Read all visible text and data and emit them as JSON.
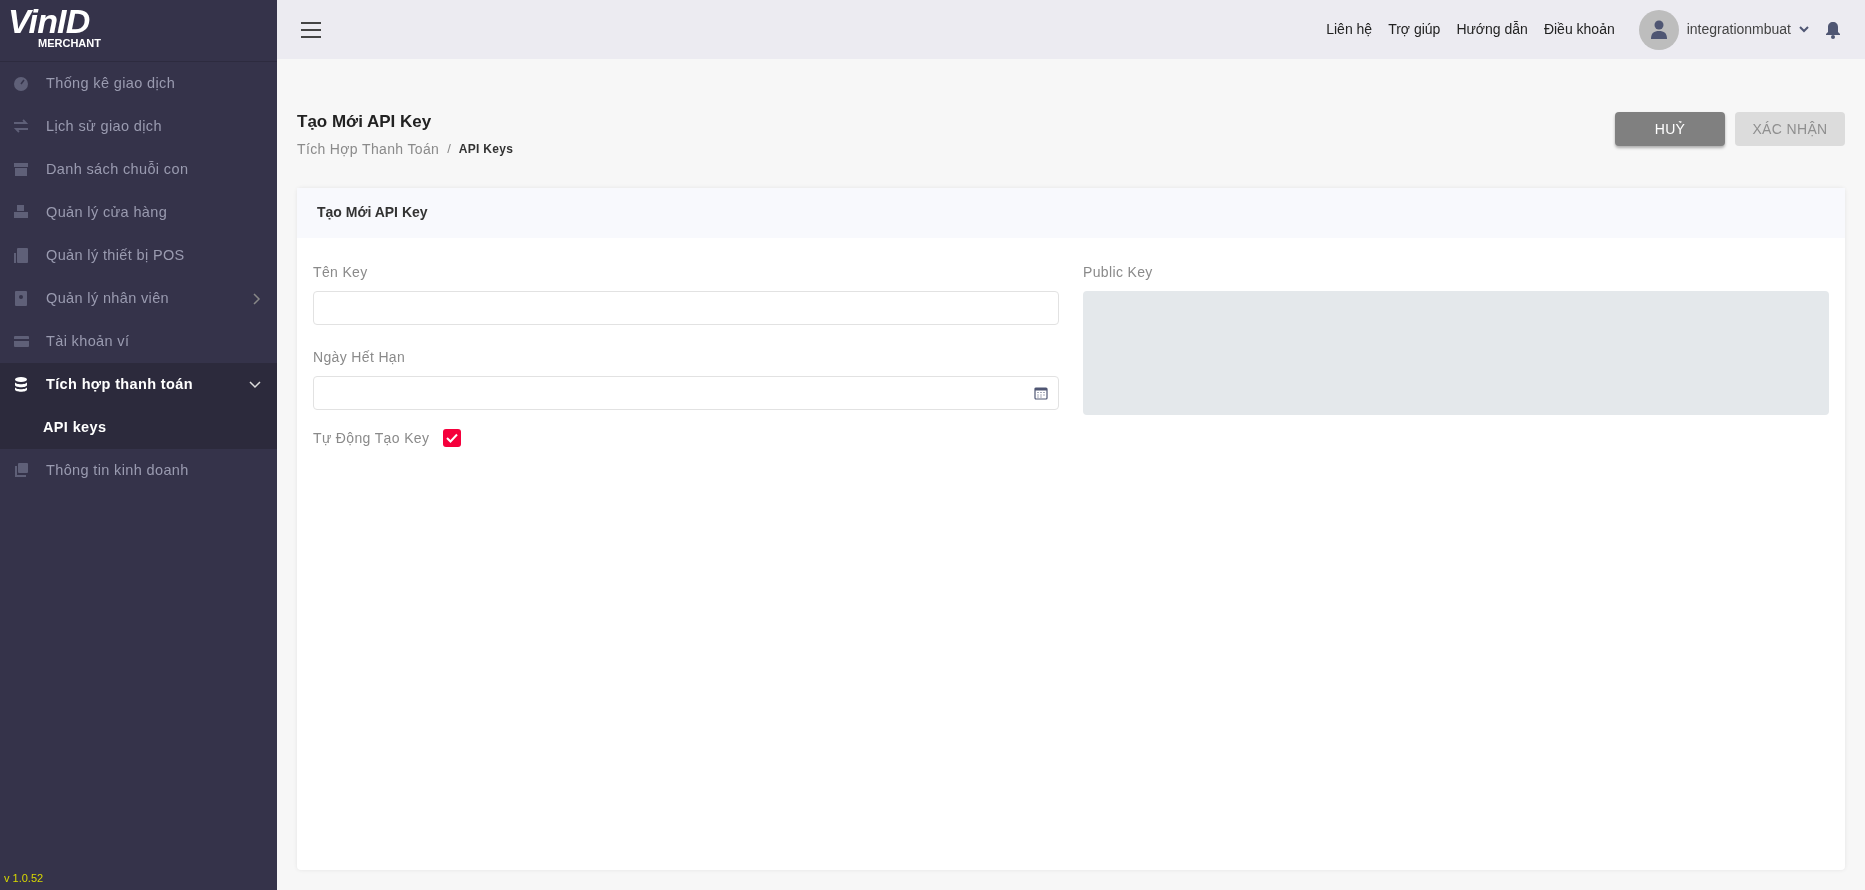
{
  "logo": {
    "title": "VinID",
    "subtitle": "MERCHANT"
  },
  "sidebar": {
    "items": [
      {
        "label": "Thống kê giao dịch",
        "selected": false
      },
      {
        "label": "Lịch sử giao dịch",
        "selected": false
      },
      {
        "label": "Danh sách chuỗi con",
        "selected": false
      },
      {
        "label": "Quản lý cửa hàng",
        "selected": false
      },
      {
        "label": "Quản lý thiết bị POS",
        "selected": false
      },
      {
        "label": "Quản lý nhân viên",
        "selected": false,
        "expanded": false
      },
      {
        "label": "Tài khoản ví",
        "selected": false
      },
      {
        "label": "Tích hợp thanh toán",
        "selected": true,
        "expanded": true,
        "children": [
          {
            "label": "API keys",
            "selected": true
          }
        ]
      },
      {
        "label": "Thông tin kinh doanh",
        "selected": false
      }
    ],
    "version": "v 1.0.52"
  },
  "header": {
    "links": [
      "Liên hệ",
      "Trợ giúp",
      "Hướng dẫn",
      "Điều khoản"
    ],
    "user": "integrationmbuat"
  },
  "page": {
    "title": "Tạo Mới API Key",
    "breadcrumb": [
      {
        "label": "Tích Hợp Thanh Toán",
        "current": false
      },
      {
        "label": "API Keys",
        "current": true
      }
    ],
    "breadcrumb_separator": "/",
    "buttons": [
      {
        "label": "HUỶ",
        "disabled": false
      },
      {
        "label": "XÁC NHẬN",
        "disabled": true
      }
    ]
  },
  "card": {
    "title": "Tạo Mới API Key",
    "fields": [
      {
        "label": "Tên Key",
        "kind": "text"
      },
      {
        "label": "Ngày Hết Hạn",
        "kind": "date"
      }
    ],
    "checkbox": {
      "label": "Tự Động Tạo Key",
      "checked": true
    },
    "public_key": {
      "label": "Public Key",
      "disabled": true
    }
  }
}
